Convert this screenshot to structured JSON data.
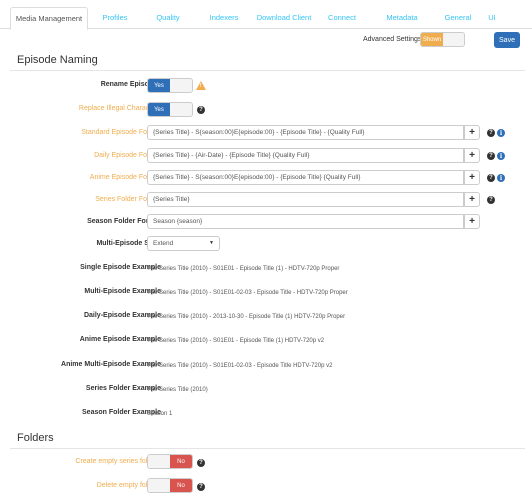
{
  "tabs": [
    {
      "label": "Media Management",
      "active": true
    },
    {
      "label": "Profiles"
    },
    {
      "label": "Quality"
    },
    {
      "label": "Indexers"
    },
    {
      "label": "Download Client"
    },
    {
      "label": "Connect"
    },
    {
      "label": "Metadata"
    },
    {
      "label": "General"
    },
    {
      "label": "UI"
    }
  ],
  "toolbar": {
    "advanced_label": "Advanced Settings",
    "advanced_state": "Shown",
    "save_label": "Save"
  },
  "episode_naming": {
    "title": "Episode Naming",
    "rename_label": "Rename Episodes",
    "rename_value": "Yes",
    "replace_label": "Replace Illegal Characters",
    "replace_value": "Yes",
    "standard_label": "Standard Episode Format",
    "standard_value": "{Series Title} - S{season:00}E{episode:00} - {Episode Title} - {Quality Full}",
    "daily_label": "Daily Episode Format",
    "daily_value": "{Series Title} - {Air-Date} - {Episode Title} {Quality Full}",
    "anime_label": "Anime Episode Format",
    "anime_value": "{Series Title} - S{season:00}E{episode:00} - {Episode Title} {Quality Full}",
    "series_folder_label": "Series Folder Format",
    "series_folder_value": "{Series Title}",
    "season_folder_label": "Season Folder Format",
    "season_folder_value": "Season {season}",
    "multi_style_label": "Multi-Episode Style",
    "multi_style_value": "Extend",
    "single_example_label": "Single Episode Example",
    "single_example_value": "The Series Title (2010) - S01E01 - Episode Title (1) - HDTV-720p Proper",
    "multi_example_label": "Multi-Episode Example",
    "multi_example_value": "The Series Title (2010) - S01E01-02-03 - Episode Title - HDTV-720p Proper",
    "daily_example_label": "Daily-Episode Example",
    "daily_example_value": "The Series Title (2010) - 2013-10-30 - Episode Title (1) HDTV-720p Proper",
    "anime_example_label": "Anime Episode Example",
    "anime_example_value": "The Series Title (2010) - S01E01 - Episode Title (1) HDTV-720p v2",
    "anime_multi_example_label": "Anime Multi-Episode Example",
    "anime_multi_example_value": "The Series Title (2010) - S01E01-02-03 - Episode Title HDTV-720p v2",
    "series_folder_example_label": "Series Folder Example",
    "series_folder_example_value": "The Series Title (2010)",
    "season_folder_example_label": "Season Folder Example",
    "season_folder_example_value": "Season 1"
  },
  "folders": {
    "title": "Folders",
    "create_empty_label": "Create empty series folders",
    "create_empty_value": "No",
    "delete_empty_label": "Delete empty folders",
    "delete_empty_value": "No"
  },
  "icons": {
    "plus": "+",
    "question": "?",
    "info": "i",
    "warning": "!",
    "caret": "▼"
  },
  "colors": {
    "primary": "#2f6fb7",
    "warning": "#f0ad4e",
    "danger": "#d9534f",
    "link": "#35c5f4"
  }
}
